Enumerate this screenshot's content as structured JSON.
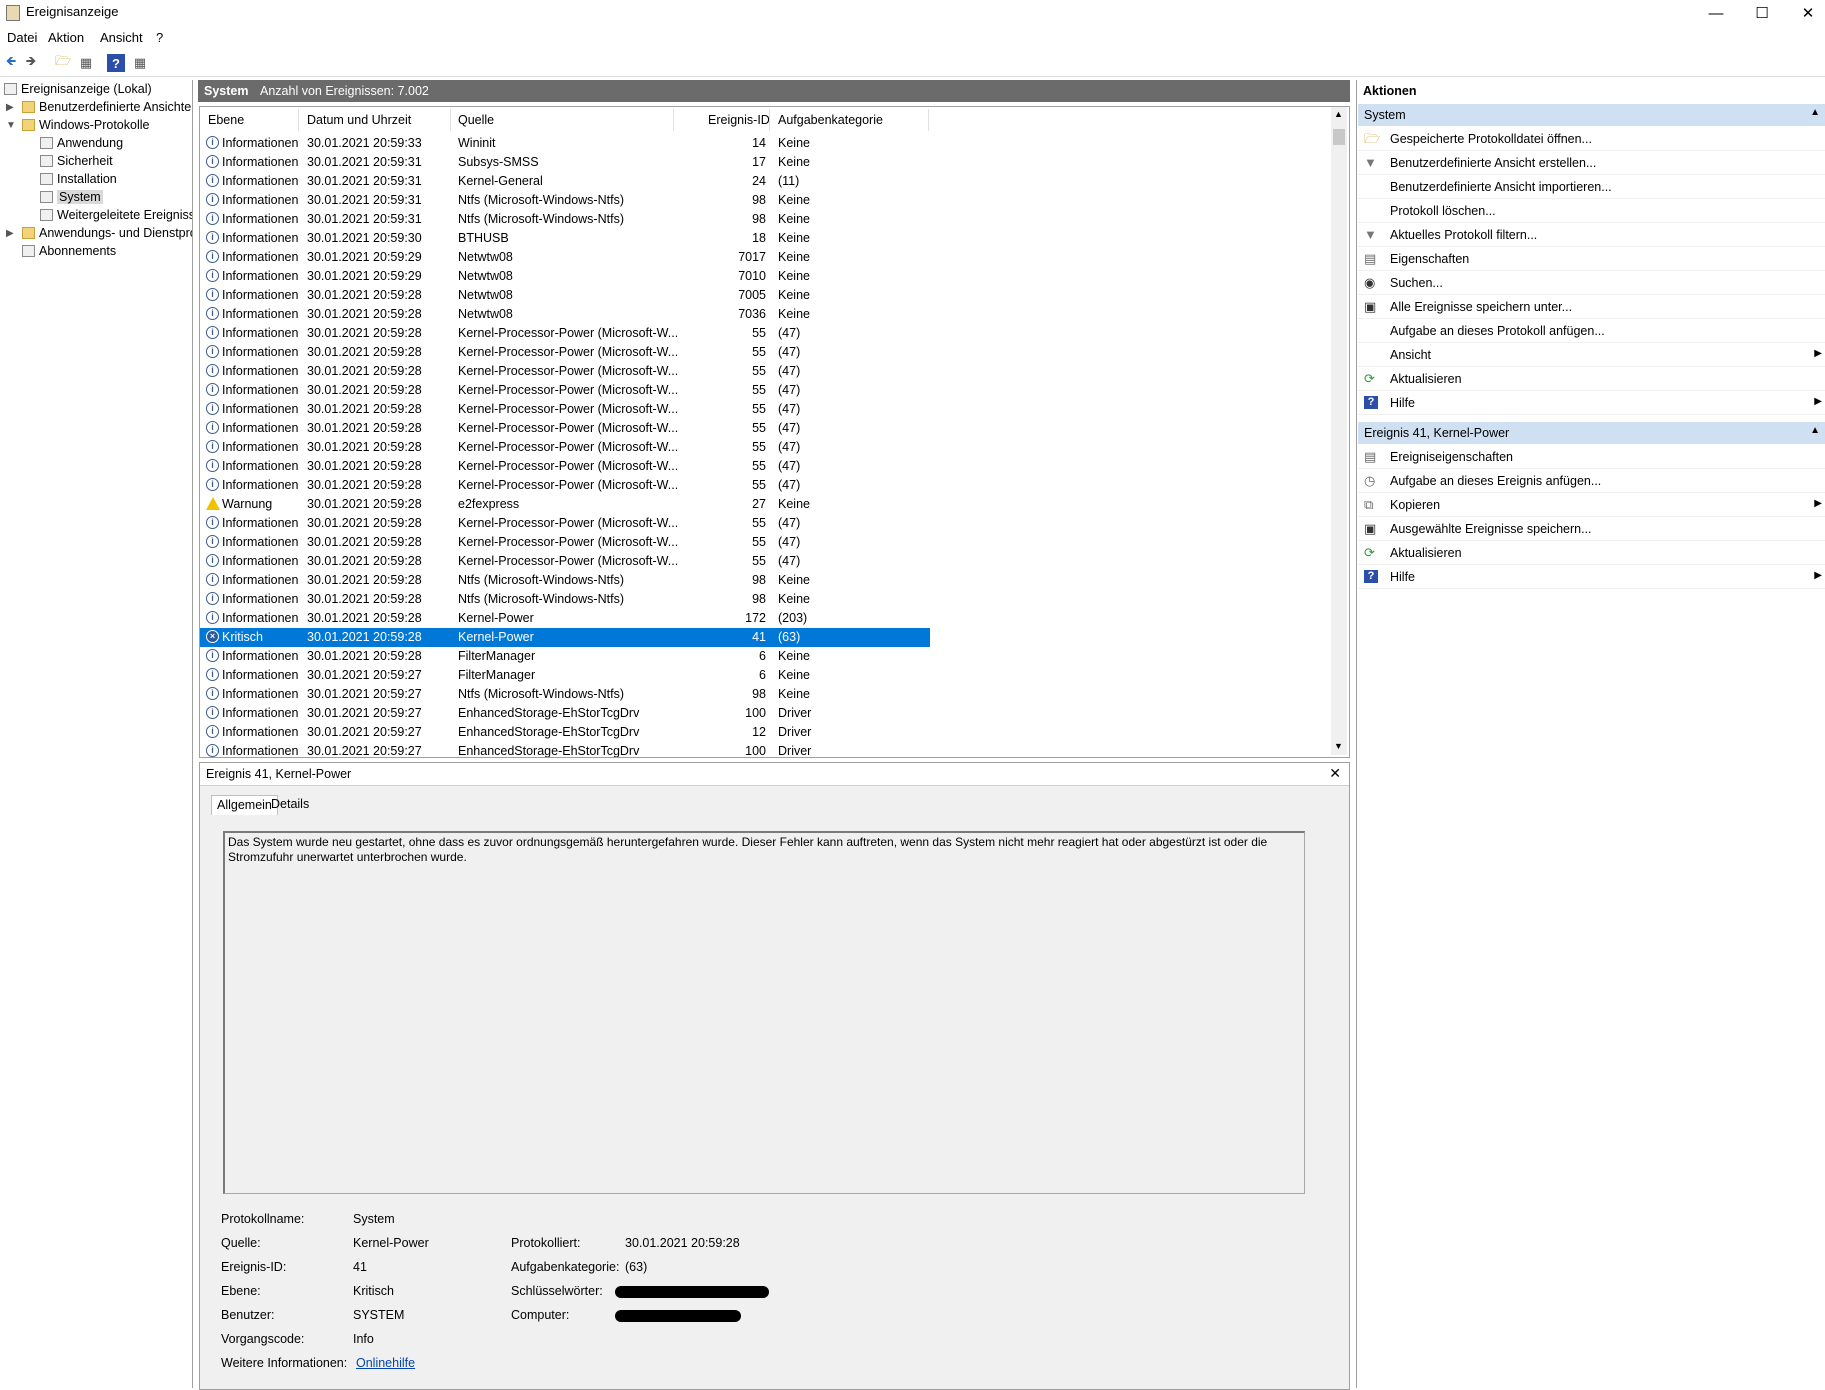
{
  "window": {
    "title": "Ereignisanzeige"
  },
  "menu": [
    "Datei",
    "Aktion",
    "Ansicht",
    "?"
  ],
  "tree": {
    "root": "Ereignisanzeige (Lokal)",
    "custom_views": "Benutzerdefinierte Ansichten",
    "windows_logs": "Windows-Protokolle",
    "logs": [
      "Anwendung",
      "Sicherheit",
      "Installation",
      "System",
      "Weitergeleitete Ereignisse"
    ],
    "app_services": "Anwendungs- und Dienstprotokolle",
    "subscriptions": "Abonnements"
  },
  "center": {
    "title": "System",
    "count_text": "Anzahl von Ereignissen: 7.002"
  },
  "columns": [
    "Ebene",
    "Datum und Uhrzeit",
    "Quelle",
    "Ereignis-ID",
    "Aufgabenkategorie"
  ],
  "events": [
    {
      "level": "Informationen",
      "date": "30.01.2021 20:59:33",
      "source": "Wininit",
      "id": "14",
      "cat": "Keine",
      "icon": "info"
    },
    {
      "level": "Informationen",
      "date": "30.01.2021 20:59:31",
      "source": "Subsys-SMSS",
      "id": "17",
      "cat": "Keine",
      "icon": "info"
    },
    {
      "level": "Informationen",
      "date": "30.01.2021 20:59:31",
      "source": "Kernel-General",
      "id": "24",
      "cat": "(11)",
      "icon": "info"
    },
    {
      "level": "Informationen",
      "date": "30.01.2021 20:59:31",
      "source": "Ntfs (Microsoft-Windows-Ntfs)",
      "id": "98",
      "cat": "Keine",
      "icon": "info"
    },
    {
      "level": "Informationen",
      "date": "30.01.2021 20:59:31",
      "source": "Ntfs (Microsoft-Windows-Ntfs)",
      "id": "98",
      "cat": "Keine",
      "icon": "info"
    },
    {
      "level": "Informationen",
      "date": "30.01.2021 20:59:30",
      "source": "BTHUSB",
      "id": "18",
      "cat": "Keine",
      "icon": "info"
    },
    {
      "level": "Informationen",
      "date": "30.01.2021 20:59:29",
      "source": "Netwtw08",
      "id": "7017",
      "cat": "Keine",
      "icon": "info"
    },
    {
      "level": "Informationen",
      "date": "30.01.2021 20:59:29",
      "source": "Netwtw08",
      "id": "7010",
      "cat": "Keine",
      "icon": "info"
    },
    {
      "level": "Informationen",
      "date": "30.01.2021 20:59:28",
      "source": "Netwtw08",
      "id": "7005",
      "cat": "Keine",
      "icon": "info"
    },
    {
      "level": "Informationen",
      "date": "30.01.2021 20:59:28",
      "source": "Netwtw08",
      "id": "7036",
      "cat": "Keine",
      "icon": "info"
    },
    {
      "level": "Informationen",
      "date": "30.01.2021 20:59:28",
      "source": "Kernel-Processor-Power (Microsoft-W...",
      "id": "55",
      "cat": "(47)",
      "icon": "info"
    },
    {
      "level": "Informationen",
      "date": "30.01.2021 20:59:28",
      "source": "Kernel-Processor-Power (Microsoft-W...",
      "id": "55",
      "cat": "(47)",
      "icon": "info"
    },
    {
      "level": "Informationen",
      "date": "30.01.2021 20:59:28",
      "source": "Kernel-Processor-Power (Microsoft-W...",
      "id": "55",
      "cat": "(47)",
      "icon": "info"
    },
    {
      "level": "Informationen",
      "date": "30.01.2021 20:59:28",
      "source": "Kernel-Processor-Power (Microsoft-W...",
      "id": "55",
      "cat": "(47)",
      "icon": "info"
    },
    {
      "level": "Informationen",
      "date": "30.01.2021 20:59:28",
      "source": "Kernel-Processor-Power (Microsoft-W...",
      "id": "55",
      "cat": "(47)",
      "icon": "info"
    },
    {
      "level": "Informationen",
      "date": "30.01.2021 20:59:28",
      "source": "Kernel-Processor-Power (Microsoft-W...",
      "id": "55",
      "cat": "(47)",
      "icon": "info"
    },
    {
      "level": "Informationen",
      "date": "30.01.2021 20:59:28",
      "source": "Kernel-Processor-Power (Microsoft-W...",
      "id": "55",
      "cat": "(47)",
      "icon": "info"
    },
    {
      "level": "Informationen",
      "date": "30.01.2021 20:59:28",
      "source": "Kernel-Processor-Power (Microsoft-W...",
      "id": "55",
      "cat": "(47)",
      "icon": "info"
    },
    {
      "level": "Informationen",
      "date": "30.01.2021 20:59:28",
      "source": "Kernel-Processor-Power (Microsoft-W...",
      "id": "55",
      "cat": "(47)",
      "icon": "info"
    },
    {
      "level": "Warnung",
      "date": "30.01.2021 20:59:28",
      "source": "e2fexpress",
      "id": "27",
      "cat": "Keine",
      "icon": "warn"
    },
    {
      "level": "Informationen",
      "date": "30.01.2021 20:59:28",
      "source": "Kernel-Processor-Power (Microsoft-W...",
      "id": "55",
      "cat": "(47)",
      "icon": "info"
    },
    {
      "level": "Informationen",
      "date": "30.01.2021 20:59:28",
      "source": "Kernel-Processor-Power (Microsoft-W...",
      "id": "55",
      "cat": "(47)",
      "icon": "info"
    },
    {
      "level": "Informationen",
      "date": "30.01.2021 20:59:28",
      "source": "Kernel-Processor-Power (Microsoft-W...",
      "id": "55",
      "cat": "(47)",
      "icon": "info"
    },
    {
      "level": "Informationen",
      "date": "30.01.2021 20:59:28",
      "source": "Ntfs (Microsoft-Windows-Ntfs)",
      "id": "98",
      "cat": "Keine",
      "icon": "info"
    },
    {
      "level": "Informationen",
      "date": "30.01.2021 20:59:28",
      "source": "Ntfs (Microsoft-Windows-Ntfs)",
      "id": "98",
      "cat": "Keine",
      "icon": "info"
    },
    {
      "level": "Informationen",
      "date": "30.01.2021 20:59:28",
      "source": "Kernel-Power",
      "id": "172",
      "cat": "(203)",
      "icon": "info"
    },
    {
      "level": "Kritisch",
      "date": "30.01.2021 20:59:28",
      "source": "Kernel-Power",
      "id": "41",
      "cat": "(63)",
      "icon": "crit",
      "selected": true
    },
    {
      "level": "Informationen",
      "date": "30.01.2021 20:59:28",
      "source": "FilterManager",
      "id": "6",
      "cat": "Keine",
      "icon": "info"
    },
    {
      "level": "Informationen",
      "date": "30.01.2021 20:59:27",
      "source": "FilterManager",
      "id": "6",
      "cat": "Keine",
      "icon": "info"
    },
    {
      "level": "Informationen",
      "date": "30.01.2021 20:59:27",
      "source": "Ntfs (Microsoft-Windows-Ntfs)",
      "id": "98",
      "cat": "Keine",
      "icon": "info"
    },
    {
      "level": "Informationen",
      "date": "30.01.2021 20:59:27",
      "source": "EnhancedStorage-EhStorTcgDrv",
      "id": "100",
      "cat": "Driver",
      "icon": "info"
    },
    {
      "level": "Informationen",
      "date": "30.01.2021 20:59:27",
      "source": "EnhancedStorage-EhStorTcgDrv",
      "id": "12",
      "cat": "Driver",
      "icon": "info"
    },
    {
      "level": "Informationen",
      "date": "30.01.2021 20:59:27",
      "source": "EnhancedStorage-EhStorTcgDrv",
      "id": "100",
      "cat": "Driver",
      "icon": "info"
    }
  ],
  "detail": {
    "title": "Ereignis 41, Kernel-Power",
    "tabs": [
      "Allgemein",
      "Details"
    ],
    "description": "Das System wurde neu gestartet, ohne dass es zuvor ordnungsgemäß heruntergefahren wurde. Dieser Fehler kann auftreten, wenn das System nicht mehr reagiert hat oder abgestürzt ist oder die Stromzufuhr unerwartet unterbrochen wurde.",
    "labels": {
      "logname": "Protokollname:",
      "source": "Quelle:",
      "eventid": "Ereignis-ID:",
      "level": "Ebene:",
      "user": "Benutzer:",
      "opcode": "Vorgangscode:",
      "moreinfo": "Weitere Informationen:",
      "logged": "Protokolliert:",
      "taskcat": "Aufgabenkategorie:",
      "keywords": "Schlüsselwörter:",
      "computer": "Computer:"
    },
    "values": {
      "logname": "System",
      "source": "Kernel-Power",
      "eventid": "41",
      "level": "Kritisch",
      "user": "SYSTEM",
      "opcode": "Info",
      "moreinfo": "Onlinehilfe",
      "logged": "30.01.2021 20:59:28",
      "taskcat": "(63)"
    }
  },
  "actions": {
    "title": "Aktionen",
    "section1": "System",
    "items1": [
      {
        "label": "Gespeicherte Protokolldatei öffnen...",
        "icon": "open-folder-icon"
      },
      {
        "label": "Benutzerdefinierte Ansicht erstellen...",
        "icon": "filter-icon"
      },
      {
        "label": "Benutzerdefinierte Ansicht importieren...",
        "icon": ""
      },
      {
        "label": "Protokoll löschen...",
        "icon": ""
      },
      {
        "label": "Aktuelles Protokoll filtern...",
        "icon": "filter-icon"
      },
      {
        "label": "Eigenschaften",
        "icon": "properties-icon"
      },
      {
        "label": "Suchen...",
        "icon": "binoculars-icon"
      },
      {
        "label": "Alle Ereignisse speichern unter...",
        "icon": "save-icon"
      },
      {
        "label": "Aufgabe an dieses Protokoll anfügen...",
        "icon": ""
      },
      {
        "label": "Ansicht",
        "icon": "",
        "submenu": true
      },
      {
        "label": "Aktualisieren",
        "icon": "refresh-icon"
      },
      {
        "label": "Hilfe",
        "icon": "help-icon",
        "submenu": true
      }
    ],
    "section2": "Ereignis 41, Kernel-Power",
    "items2": [
      {
        "label": "Ereigniseigenschaften",
        "icon": "properties-icon"
      },
      {
        "label": "Aufgabe an dieses Ereignis anfügen...",
        "icon": "task-icon"
      },
      {
        "label": "Kopieren",
        "icon": "copy-icon",
        "submenu": true
      },
      {
        "label": "Ausgewählte Ereignisse speichern...",
        "icon": "save-icon"
      },
      {
        "label": "Aktualisieren",
        "icon": "refresh-icon"
      },
      {
        "label": "Hilfe",
        "icon": "help-icon",
        "submenu": true
      }
    ]
  },
  "colors": {
    "selection": "#0078d7",
    "section_header": "#cfe0f2",
    "center_header": "#6b6b6b"
  }
}
